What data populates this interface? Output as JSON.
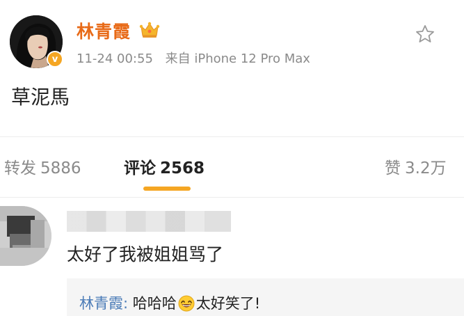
{
  "post": {
    "author": {
      "name": "林青霞",
      "avatar": "avatar",
      "verified_icon": "verified-v-icon",
      "member_icon": "crown-icon"
    },
    "verified_badge": "v",
    "timestamp": "11-24 00:55",
    "source": "来自 iPhone 12 Pro Max",
    "favorite_icon": "star-outline-icon",
    "text": "草泥馬"
  },
  "tabs": {
    "repost": {
      "label": "转发",
      "count": "5886"
    },
    "comment": {
      "label": "评论",
      "count": "2568",
      "active": true
    },
    "like": {
      "label": "赞",
      "count": "3.2万"
    }
  },
  "comment": {
    "avatar": "blurred-avatar",
    "username_blurred": true,
    "text": "太好了我被姐姐骂了",
    "reply": {
      "author": "林青霞:",
      "text_before": "哈哈哈",
      "emoji": "grinning-emoji",
      "text_after": "太好笑了!"
    }
  },
  "colors": {
    "author_name": "#e86a17",
    "accent": "#f5a623",
    "reply_author": "#4a7bb7",
    "meta_text": "#8a8a8a"
  }
}
